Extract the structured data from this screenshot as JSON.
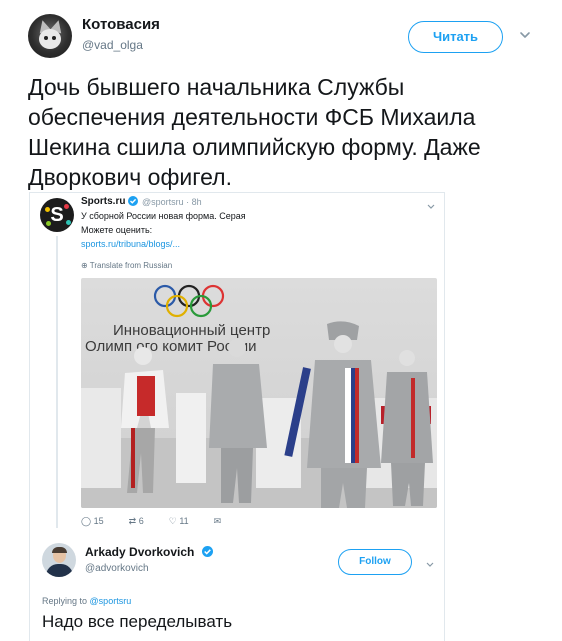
{
  "outer_tweet": {
    "display_name": "Котовасия",
    "handle": "@vad_olga",
    "follow_label": "Читать",
    "text": "Дочь бывшего начальника Службы обеспечения деятельности ФСБ Михаила Шекина сшила олимпийскую форму. Даже Дворкович офигел."
  },
  "embedded_tweet": {
    "logo_letter": "S",
    "display_name": "Sports.ru",
    "handle_time": "@sportsru · 8h",
    "text_line1": "У сборной России новая форма. Серая",
    "text_line2": "Можете оценить:",
    "link": "sports.ru/tribuna/blogs/...",
    "translate": "Translate from Russian",
    "photo_caption_line1": "Инновационный центр",
    "photo_caption_line2": "Олимп   ого комит   России",
    "actions": {
      "replies": "15",
      "retweets": "6",
      "likes": "11"
    }
  },
  "reply_tweet": {
    "display_name": "Arkady Dvorkovich",
    "handle": "@advorkovich",
    "follow_label": "Follow",
    "replying_prefix": "Replying to",
    "replying_to": "@sportsru",
    "text": "Надо все переделывать"
  },
  "colors": {
    "twitter_blue": "#1da1f2",
    "link_blue": "#1b95e0",
    "muted_text": "#657786"
  },
  "icons": [
    "chevron-down-icon",
    "verified-badge-icon",
    "globe-icon",
    "reply-icon",
    "retweet-icon",
    "like-icon",
    "message-icon",
    "olympic-rings-icon"
  ]
}
